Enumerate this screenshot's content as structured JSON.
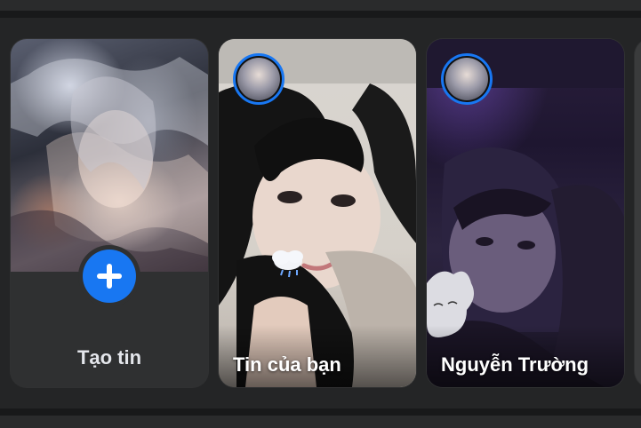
{
  "create_story": {
    "label": "Tạo tin",
    "icon": "plus-icon"
  },
  "stories": [
    {
      "name": "Tin của bạn",
      "avatar_icon": "avatar-icon"
    },
    {
      "name": "Nguyễn Trường",
      "avatar_icon": "avatar-icon"
    }
  ],
  "colors": {
    "accent": "#1877f2",
    "background": "#242526",
    "card": "#2f3031",
    "text": "#e4e6eb"
  }
}
